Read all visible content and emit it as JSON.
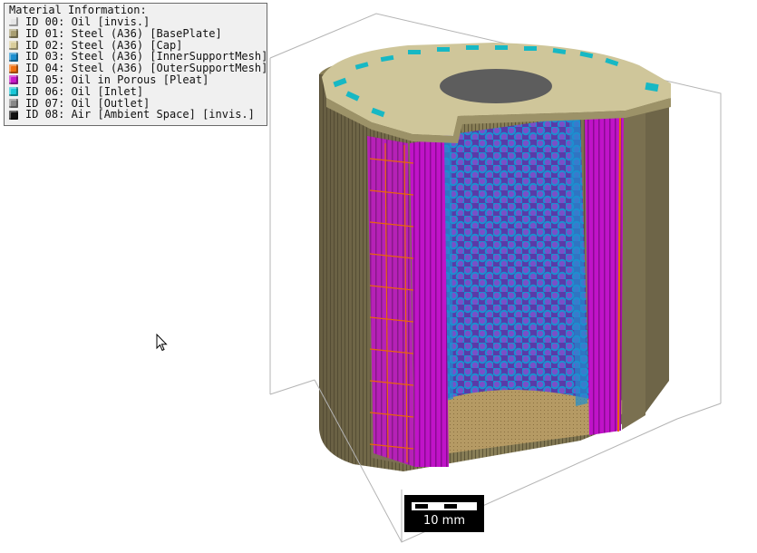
{
  "legend": {
    "title": "Material Information:",
    "items": [
      {
        "text": "ID 00: Oil [invis.]",
        "color": "#e6e6e6"
      },
      {
        "text": "ID 01: Steel (A36) [BasePlate]",
        "color": "#a89e72"
      },
      {
        "text": "ID 02: Steel (A36) [Cap]",
        "color": "#d9cd9a"
      },
      {
        "text": "ID 03: Steel (A36) [InnerSupportMesh]",
        "color": "#1f8fd0"
      },
      {
        "text": "ID 04: Steel (A36) [OuterSupportMesh]",
        "color": "#f07010"
      },
      {
        "text": "ID 05: Oil in Porous [Pleat]",
        "color": "#c81ac8"
      },
      {
        "text": "ID 06: Oil [Inlet]",
        "color": "#18c8d8"
      },
      {
        "text": "ID 07: Oil [Outlet]",
        "color": "#888888"
      },
      {
        "text": "ID 08: Air [Ambient Space] [invis.]",
        "color": "#111111"
      }
    ]
  },
  "scale_bar": {
    "label": "10 mm"
  },
  "colors": {
    "housing_dark": "#6e6548",
    "housing_light": "#b5ab7e",
    "cap": "#cfc69a",
    "pleat": "#c013c8",
    "inner_mesh": "#1c8fcf",
    "outer_mesh": "#e8650c",
    "inlet": "#17b8c4",
    "outlet": "#5d5d5d",
    "bounding_box": "#b4b4b4"
  }
}
